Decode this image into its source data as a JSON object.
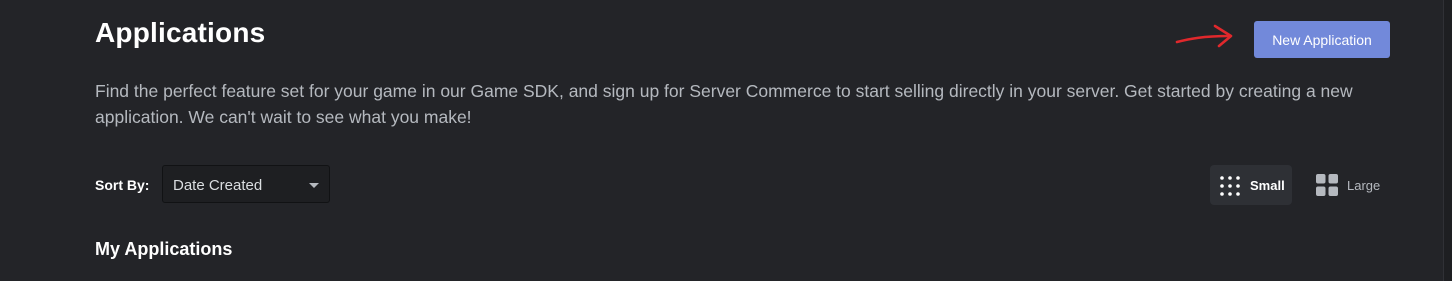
{
  "header": {
    "title": "Applications",
    "new_application_label": "New Application",
    "description": "Find the perfect feature set for your game in our Game SDK, and sign up for Server Commerce to start selling directly in your server. Get started by creating a new application. We can't wait to see what you make!"
  },
  "toolbar": {
    "sort_label": "Sort By:",
    "sort_value": "Date Created",
    "view_small_label": "Small",
    "view_large_label": "Large",
    "selected_view": "Small"
  },
  "section": {
    "title": "My Applications"
  },
  "icons": {
    "arrow": "red-arrow-annotation-icon",
    "caret": "chevron-down-icon",
    "small_view": "grid-small-icon",
    "large_view": "grid-large-icon"
  },
  "colors": {
    "background": "#232428",
    "accent": "#7289da",
    "annotation": "#e0282c",
    "text_primary": "#ffffff",
    "text_secondary": "#b5b9bf"
  }
}
